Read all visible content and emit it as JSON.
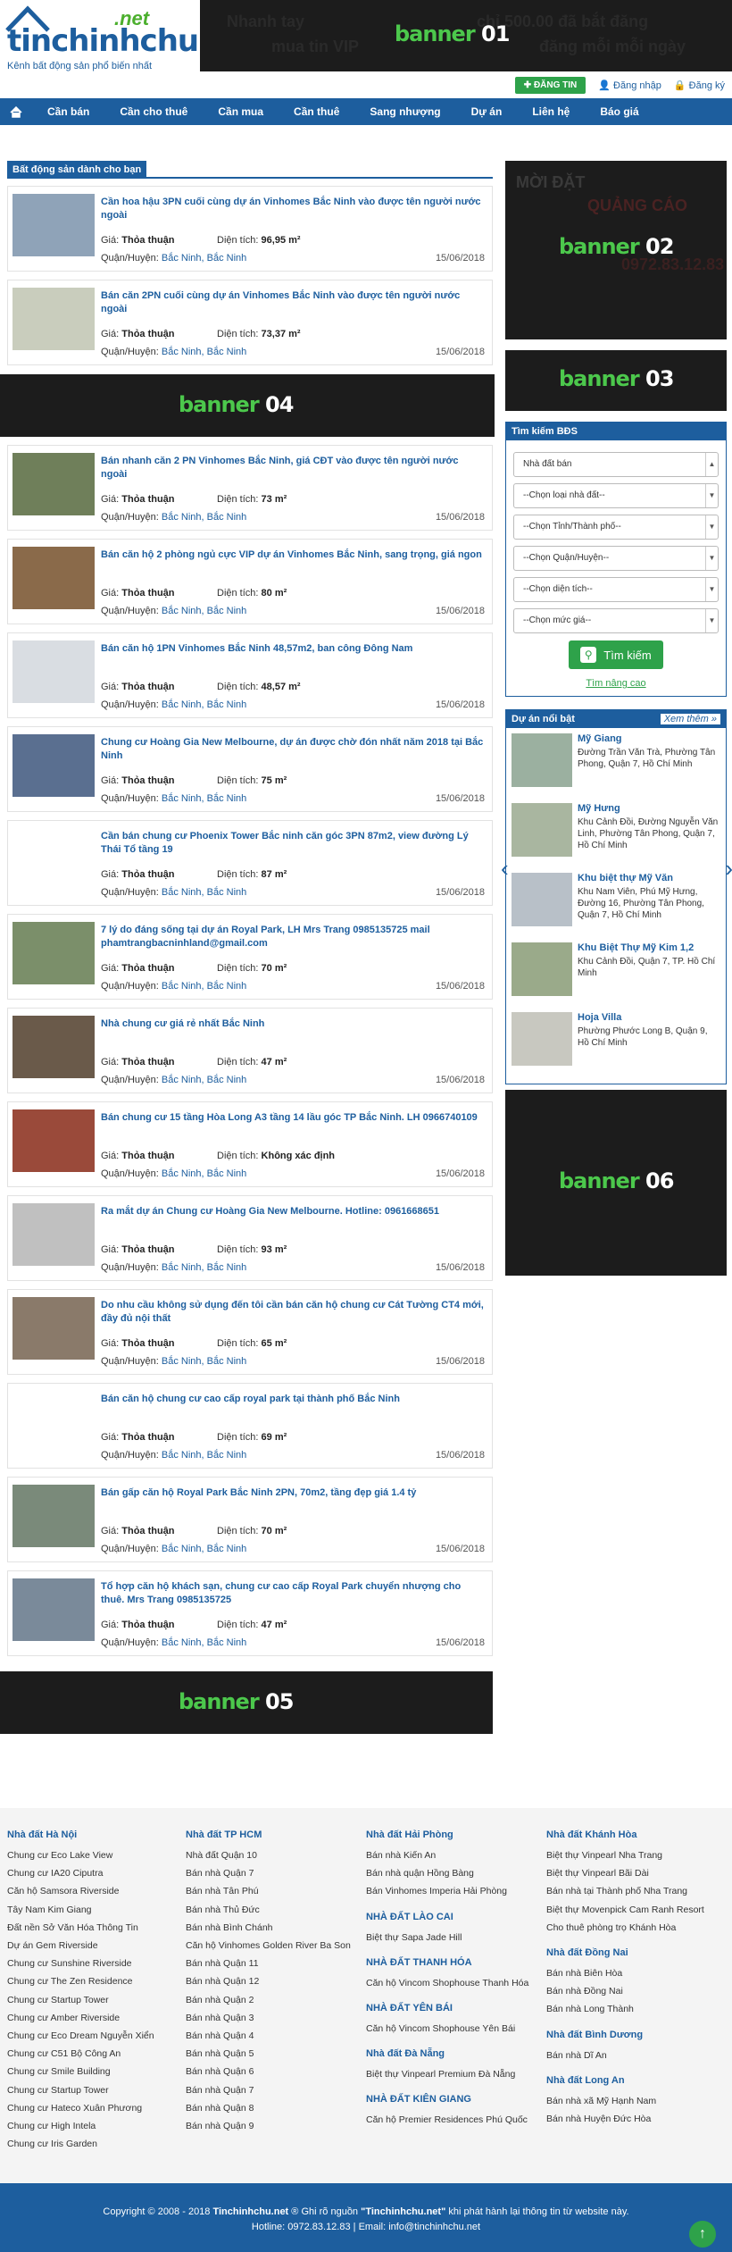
{
  "header": {
    "logo_word": "tinchinhchu",
    "logo_net": ".net",
    "tagline": "Kênh bất động sản phổ biến nhất",
    "post_button": "ĐĂNG TIN",
    "login": "Đăng nhập",
    "register": "Đăng ký"
  },
  "banners": {
    "b01": "banner",
    "b01n": "01",
    "b01_bg1": "Nhanh tay",
    "b01_bg2": "mua tin VIP",
    "b01_bg3": "chỉ 500.00 đã bắt đăng",
    "b01_bg4": "đăng mỗi mỗi ngày",
    "b02": "banner",
    "b02n": "02",
    "b02_bg1": "MỜI ĐẶT",
    "b02_bg2": "QUẢNG CÁO",
    "b02_bg3": "0972.83.12.83",
    "b03": "banner",
    "b03n": "03",
    "b04": "banner",
    "b04n": "04",
    "b05": "banner",
    "b05n": "05",
    "b06": "banner",
    "b06n": "06"
  },
  "nav": {
    "home_icon": "home-icon",
    "items": [
      "Cần bán",
      "Cần cho thuê",
      "Cần mua",
      "Cần thuê",
      "Sang nhượng",
      "Dự án",
      "Liên hệ",
      "Báo giá"
    ]
  },
  "section": {
    "title": "Bất động sản dành cho bạn"
  },
  "labels": {
    "price": "Giá:",
    "area": "Diện tích:",
    "district": "Quận/Huyện:"
  },
  "listings": [
    {
      "title": "Cần hoa hậu 3PN cuối cùng dự án Vinhomes Bắc Ninh vào được tên người nước ngoài",
      "price": "Thỏa thuận",
      "area": "96,95 m²",
      "district": "Bắc Ninh, Bắc Ninh",
      "date": "15/06/2018"
    },
    {
      "title": "Bán căn 2PN cuối cùng dự án Vinhomes Bắc Ninh vào được tên người nước ngoài",
      "price": "Thỏa thuận",
      "area": "73,37 m²",
      "district": "Bắc Ninh, Bắc Ninh",
      "date": "15/06/2018"
    },
    {
      "title": "Bán nhanh căn 2 PN Vinhomes Bắc Ninh, giá CĐT vào được tên người nước ngoài",
      "price": "Thỏa thuận",
      "area": "73 m²",
      "district": "Bắc Ninh, Bắc Ninh",
      "date": "15/06/2018"
    },
    {
      "title": "Bán căn hộ 2 phòng ngủ cực VIP dự án Vinhomes Bắc Ninh, sang trọng, giá ngon",
      "price": "Thỏa thuận",
      "area": "80 m²",
      "district": "Bắc Ninh, Bắc Ninh",
      "date": "15/06/2018"
    },
    {
      "title": "Bán căn hộ 1PN Vinhomes Bắc Ninh 48,57m2, ban công Đông Nam",
      "price": "Thỏa thuận",
      "area": "48,57 m²",
      "district": "Bắc Ninh, Bắc Ninh",
      "date": "15/06/2018"
    },
    {
      "title": "Chung cư Hoàng Gia New Melbourne, dự án được chờ đón nhất năm 2018 tại Bắc Ninh",
      "price": "Thỏa thuận",
      "area": "75 m²",
      "district": "Bắc Ninh, Bắc Ninh",
      "date": "15/06/2018"
    },
    {
      "title": "Cần bán chung cư Phoenix Tower Bắc ninh căn góc 3PN 87m2, view đường Lý Thái Tổ tầng 19",
      "price": "Thỏa thuận",
      "area": "87 m²",
      "district": "Bắc Ninh, Bắc Ninh",
      "date": "15/06/2018"
    },
    {
      "title": "7 lý do đáng sống tại dự án Royal Park, LH Mrs Trang 0985135725 mail phamtrangbacninhland@gmail.com",
      "price": "Thỏa thuận",
      "area": "70 m²",
      "district": "Bắc Ninh, Bắc Ninh",
      "date": "15/06/2018"
    },
    {
      "title": "Nhà chung cư giá rẻ nhất Bắc Ninh",
      "price": "Thỏa thuận",
      "area": "47 m²",
      "district": "Bắc Ninh, Bắc Ninh",
      "date": "15/06/2018"
    },
    {
      "title": "Bán chung cư 15 tầng Hòa Long A3 tầng 14 lầu góc TP Bắc Ninh. LH 0966740109",
      "price": "Thỏa thuận",
      "area": "Không xác định",
      "district": "Bắc Ninh, Bắc Ninh",
      "date": "15/06/2018"
    },
    {
      "title": "Ra mắt dự án Chung cư Hoàng Gia New Melbourne. Hotline: 0961668651",
      "price": "Thỏa thuận",
      "area": "93 m²",
      "district": "Bắc Ninh, Bắc Ninh",
      "date": "15/06/2018"
    },
    {
      "title": "Do nhu cầu không sử dụng đến tôi cần bán căn hộ chung cư Cát Tường CT4 mới, đầy đủ nội thất",
      "price": "Thỏa thuận",
      "area": "65 m²",
      "district": "Bắc Ninh, Bắc Ninh",
      "date": "15/06/2018"
    },
    {
      "title": "Bán căn hộ chung cư cao cấp royal park tại thành phố Bắc Ninh",
      "price": "Thỏa thuận",
      "area": "69 m²",
      "district": "Bắc Ninh, Bắc Ninh",
      "date": "15/06/2018"
    },
    {
      "title": "Bán gấp căn hộ Royal Park Bắc Ninh 2PN, 70m2, tầng đẹp giá 1.4 tỷ",
      "price": "Thỏa thuận",
      "area": "70 m²",
      "district": "Bắc Ninh, Bắc Ninh",
      "date": "15/06/2018"
    },
    {
      "title": "Tổ hợp căn hộ khách sạn, chung cư cao cấp Royal Park chuyển nhượng cho thuê. Mrs Trang 0985135725",
      "price": "Thỏa thuận",
      "area": "47 m²",
      "district": "Bắc Ninh, Bắc Ninh",
      "date": "15/06/2018"
    }
  ],
  "search": {
    "title": "Tìm kiếm BĐS",
    "selects": [
      "Nhà đất bán",
      "--Chọn loại nhà đất--",
      "--Chọn Tỉnh/Thành phố--",
      "--Chọn Quận/Huyện--",
      "--Chọn diện tích--",
      "--Chọn mức giá--"
    ],
    "button": "Tìm kiếm",
    "advanced": "Tìm nâng cao"
  },
  "projects": {
    "title": "Dự án nổi bật",
    "more": "Xem thêm »",
    "items": [
      {
        "name": "Mỹ Giang",
        "addr": "Đường Trần Văn Trà, Phường Tân Phong, Quận 7, Hồ Chí Minh"
      },
      {
        "name": "Mỹ Hưng",
        "addr": "Khu Cảnh Đồi, Đường Nguyễn Văn Linh, Phường Tân Phong, Quận 7, Hồ Chí Minh"
      },
      {
        "name": "Khu biệt thự Mỹ Văn",
        "addr": "Khu Nam Viên, Phú Mỹ Hưng, Đường 16, Phường Tân Phong, Quận 7, Hồ Chí Minh"
      },
      {
        "name": "Khu Biệt Thự Mỹ Kim 1,2",
        "addr": "Khu Cảnh Đồi, Quận 7, TP. Hồ Chí Minh"
      },
      {
        "name": "Hoja Villa",
        "addr": "Phường Phước Long B, Quận 9, Hồ Chí Minh"
      }
    ]
  },
  "footer": {
    "col1": {
      "h": "Nhà đất Hà Nội",
      "links": [
        "Chung cư Eco Lake View",
        "Chung cư IA20 Ciputra",
        "Căn hộ Samsora Riverside",
        "Tây Nam Kim Giang",
        "Đất nền Sở Văn Hóa Thông Tin",
        "Dự án Gem Riverside",
        "Chung cư Sunshine Riverside",
        "Chung cư The Zen Residence",
        "Chung cư Startup Tower",
        "Chung cư Amber Riverside",
        "Chung cư Eco Dream Nguyễn Xiển",
        "Chung cư C51 Bộ Công An",
        "Chung cư Smile Building",
        "Chung cư Startup Tower",
        "Chung cư Hateco Xuân Phương",
        "Chung cư High Intela",
        "Chung cư Iris Garden"
      ]
    },
    "col2": {
      "h": "Nhà đất TP HCM",
      "links": [
        "Nhà đất Quận 10",
        "Bán nhà Quận 7",
        "Bán nhà Tân Phú",
        "Bán nhà Thủ Đức",
        "Bán nhà Bình Chánh",
        "Căn hộ Vinhomes Golden River Ba Son",
        "Bán nhà Quận 11",
        "Bán nhà Quận 12",
        "Bán nhà Quận 2",
        "Bán nhà Quận 3",
        "Bán nhà Quận 4",
        "Bán nhà Quận 5",
        "Bán nhà Quận 6",
        "Bán nhà Quận 7",
        "Bán nhà Quận 8",
        "Bán nhà Quận 9"
      ]
    },
    "col3": [
      {
        "h": "Nhà đất Hải Phòng",
        "links": [
          "Bán nhà Kiến An",
          "Bán nhà quận Hồng Bàng",
          "Bán Vinhomes Imperia Hải Phòng"
        ]
      },
      {
        "h": "NHÀ ĐẤT LÀO CAI",
        "links": [
          "Biệt thự Sapa Jade Hill"
        ]
      },
      {
        "h": "NHÀ ĐẤT THANH HÓA",
        "links": [
          "Căn hộ Vincom Shophouse Thanh Hóa"
        ]
      },
      {
        "h": "NHÀ ĐẤT YÊN BÁI",
        "links": [
          "Căn hộ Vincom Shophouse Yên Bái"
        ]
      },
      {
        "h": "Nhà đất Đà Nẵng",
        "links": [
          "Biệt thự Vinpearl Premium Đà Nẵng"
        ]
      },
      {
        "h": "NHÀ ĐẤT KIÊN GIANG",
        "links": [
          "Căn hộ Premier Residences Phú Quốc"
        ]
      }
    ],
    "col4": [
      {
        "h": "Nhà đất Khánh Hòa",
        "links": [
          "Biệt thự Vinpearl Nha Trang",
          "Biệt thự Vinpearl Bãi Dài",
          "Bán nhà tại Thành phố Nha Trang",
          "Biệt thự Movenpick Cam Ranh Resort",
          "Cho thuê phòng trọ Khánh Hòa"
        ]
      },
      {
        "h": "Nhà đất Đồng Nai",
        "links": [
          "Bán nhà Biên Hòa",
          "Bán nhà Đồng Nai",
          "Bán nhà Long Thành"
        ]
      },
      {
        "h": "Nhà đất Bình Dương",
        "links": [
          "Bán nhà Dĩ An"
        ]
      },
      {
        "h": "Nhà đất Long An",
        "links": [
          "Bán nhà xã Mỹ Hạnh Nam",
          "Bán nhà Huyện Đức Hòa"
        ]
      }
    ]
  },
  "copyright": {
    "line1_a": "Copyright © 2008 - 2018 ",
    "line1_b": "Tinchinhchu.net",
    "line1_c": " ® Ghi rõ nguồn ",
    "line1_d": "\"Tinchinhchu.net\"",
    "line1_e": " khi phát hành lại thông tin từ website này.",
    "line2_a": "Hotline: ",
    "line2_b": "0972.83.12.83",
    "line2_c": " | Email: ",
    "line2_d": "info@tinchinhchu.net"
  }
}
